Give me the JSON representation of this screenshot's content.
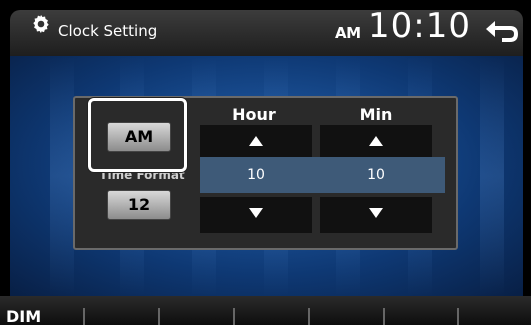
{
  "header": {
    "title": "Clock Setting",
    "ampm": "AM",
    "time": "10:10"
  },
  "panel": {
    "ampm_button": "AM",
    "time_format_label": "Time Format",
    "time_format_button": "12",
    "hour_label": "Hour",
    "min_label": "Min",
    "hour_value": "10",
    "min_value": "10"
  },
  "footer": {
    "dim_label": "DIM"
  },
  "icons": {
    "settings": "gear-icon",
    "back": "back-arrow-icon",
    "up": "triangle-up-icon",
    "down": "triangle-down-icon"
  },
  "colors": {
    "background_blue": "#1a4f94",
    "highlight": "#ffffff",
    "stripe": "#3e5a78"
  }
}
